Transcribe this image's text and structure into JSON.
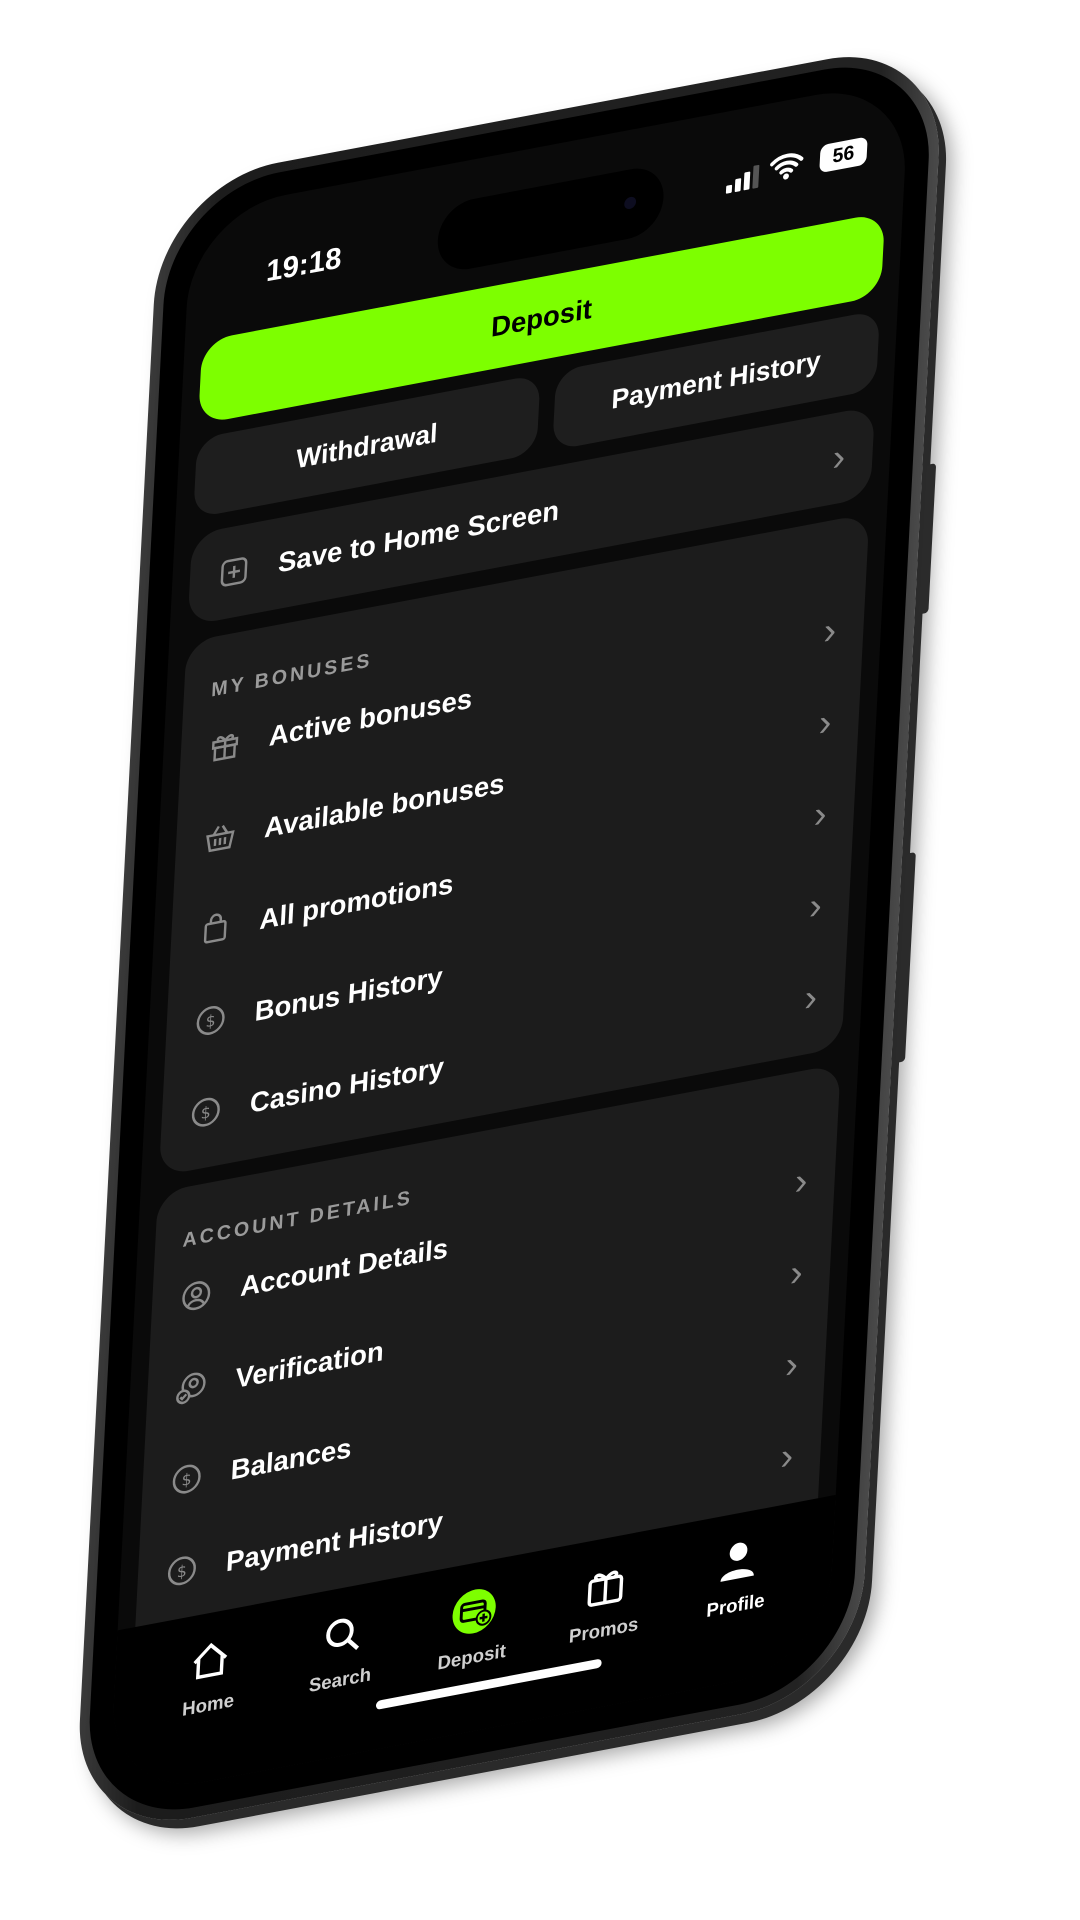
{
  "status_bar": {
    "time": "19:18",
    "battery": "56"
  },
  "wallet": {
    "deposit_label": "Deposit",
    "withdrawal_label": "Withdrawal",
    "payment_history_label": "Payment History",
    "save_home_label": "Save to Home Screen"
  },
  "bonuses": {
    "header": "MY BONUSES",
    "items": [
      {
        "label": "Active bonuses",
        "icon": "gift-icon"
      },
      {
        "label": "Available bonuses",
        "icon": "basket-icon"
      },
      {
        "label": "All promotions",
        "icon": "bag-icon"
      },
      {
        "label": "Bonus History",
        "icon": "dollar-icon"
      },
      {
        "label": "Casino History",
        "icon": "dollar-icon"
      }
    ]
  },
  "account": {
    "header": "ACCOUNT DETAILS",
    "items": [
      {
        "label": "Account Details",
        "icon": "user-circle-icon"
      },
      {
        "label": "Verification",
        "icon": "user-check-icon"
      },
      {
        "label": "Balances",
        "icon": "dollar-icon"
      },
      {
        "label": "Payment History",
        "icon": "dollar-icon"
      }
    ]
  },
  "nav": {
    "items": [
      {
        "label": "Home",
        "icon": "home-icon"
      },
      {
        "label": "Search",
        "icon": "search-icon"
      },
      {
        "label": "Deposit",
        "icon": "card-plus-icon"
      },
      {
        "label": "Promos",
        "icon": "gift-icon"
      },
      {
        "label": "Profile",
        "icon": "person-icon",
        "active": true
      }
    ]
  },
  "colors": {
    "accent": "#7dff00",
    "card": "#1c1c1c",
    "background": "#0a0a0a"
  }
}
